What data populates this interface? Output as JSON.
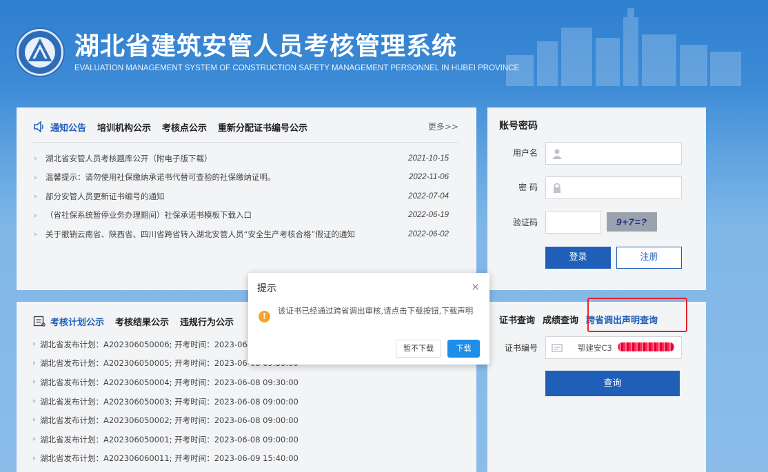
{
  "header": {
    "title": "湖北省建筑安管人员考核管理系统",
    "subtitle": "EVALUATION MANAGEMENT SYSTEM OF CONSTRUCTION SAFETY MANAGEMENT PERSONNEL IN HUBEI PROVINCE"
  },
  "notice": {
    "tabs": [
      "通知公告",
      "培训机构公示",
      "考核点公示",
      "重新分配证书编号公示"
    ],
    "more": "更多>>",
    "items": [
      {
        "title": "湖北省安管人员考核题库公开（附电子版下载）",
        "date": "2021-10-15"
      },
      {
        "title": "温馨提示：请勿使用社保缴纳承诺书代替可查验的社保缴纳证明。",
        "date": "2022-11-06"
      },
      {
        "title": "部分安管人员更新证书编号的通知",
        "date": "2022-07-04"
      },
      {
        "title": "（省社保系统暂停业务办理期间）社保承诺书模板下载入口",
        "date": "2022-06-19"
      },
      {
        "title": "关于撤销云南省、陕西省、四川省跨省转入湖北安管人员“安全生产考核合格”假证的通知",
        "date": "2022-06-02"
      }
    ]
  },
  "plan": {
    "tabs": [
      "考核计划公示",
      "考核结果公示",
      "违规行为公示"
    ],
    "items": [
      "湖北省发布计划：A202306050006; 开考时间：2023-06-08 10:00:00",
      "湖北省发布计划：A202306050005; 开考时间：2023-06-08 09:30:00",
      "湖北省发布计划：A202306050004; 开考时间：2023-06-08 09:30:00",
      "湖北省发布计划：A202306050003; 开考时间：2023-06-08 09:00:00",
      "湖北省发布计划：A202306050002; 开考时间：2023-06-08 09:00:00",
      "湖北省发布计划：A202306050001; 开考时间：2023-06-08 09:00:00",
      "湖北省发布计划：A202306060011; 开考时间：2023-06-09 15:40:00"
    ]
  },
  "login": {
    "title": "账号密码",
    "username_label": "用户名",
    "password_label": "密 码",
    "captcha_label": "验证码",
    "captcha_text": "9+7=?",
    "login_button": "登录",
    "register_button": "注册"
  },
  "cert": {
    "tabs": [
      "证书查询",
      "成绩查询",
      "跨省调出声明查询"
    ],
    "cert_no_label": "证书编号",
    "cert_no_value": "鄂建安C3",
    "query_button": "查询"
  },
  "modal": {
    "title": "提示",
    "close": "×",
    "message": "该证书已经通过跨省调出审核,请点击下载按钮,下载声明",
    "cancel_button": "暂不下载",
    "ok_button": "下载"
  },
  "colors": {
    "primary": "#1f5fb8",
    "highlight": "#e8242a",
    "warning": "#f5a524",
    "modal_ok": "#1e8ee8"
  }
}
